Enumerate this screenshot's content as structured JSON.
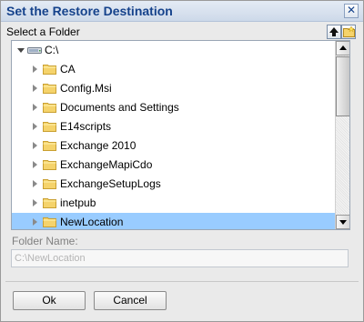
{
  "dialog": {
    "title": "Set the Restore Destination",
    "close_glyph": "✕"
  },
  "toolbar": {
    "select_label": "Select a Folder",
    "up_icon": "up-level-icon",
    "new_folder_icon": "new-folder-icon"
  },
  "tree": {
    "root": {
      "label": "C:\\",
      "icon": "drive-icon",
      "expanded": true
    },
    "items": [
      {
        "label": "CA"
      },
      {
        "label": "Config.Msi"
      },
      {
        "label": "Documents and Settings"
      },
      {
        "label": "E14scripts"
      },
      {
        "label": "Exchange 2010"
      },
      {
        "label": "ExchangeMapiCdo"
      },
      {
        "label": "ExchangeSetupLogs"
      },
      {
        "label": "inetpub"
      },
      {
        "label": "NewLocation",
        "selected": true
      }
    ]
  },
  "folder_name": {
    "label": "Folder Name:",
    "value": "C:\\NewLocation"
  },
  "buttons": {
    "ok": "Ok",
    "cancel": "Cancel"
  },
  "colors": {
    "title": "#15428b",
    "selection": "#99ccff",
    "folder_fill": "#f5d36b"
  }
}
